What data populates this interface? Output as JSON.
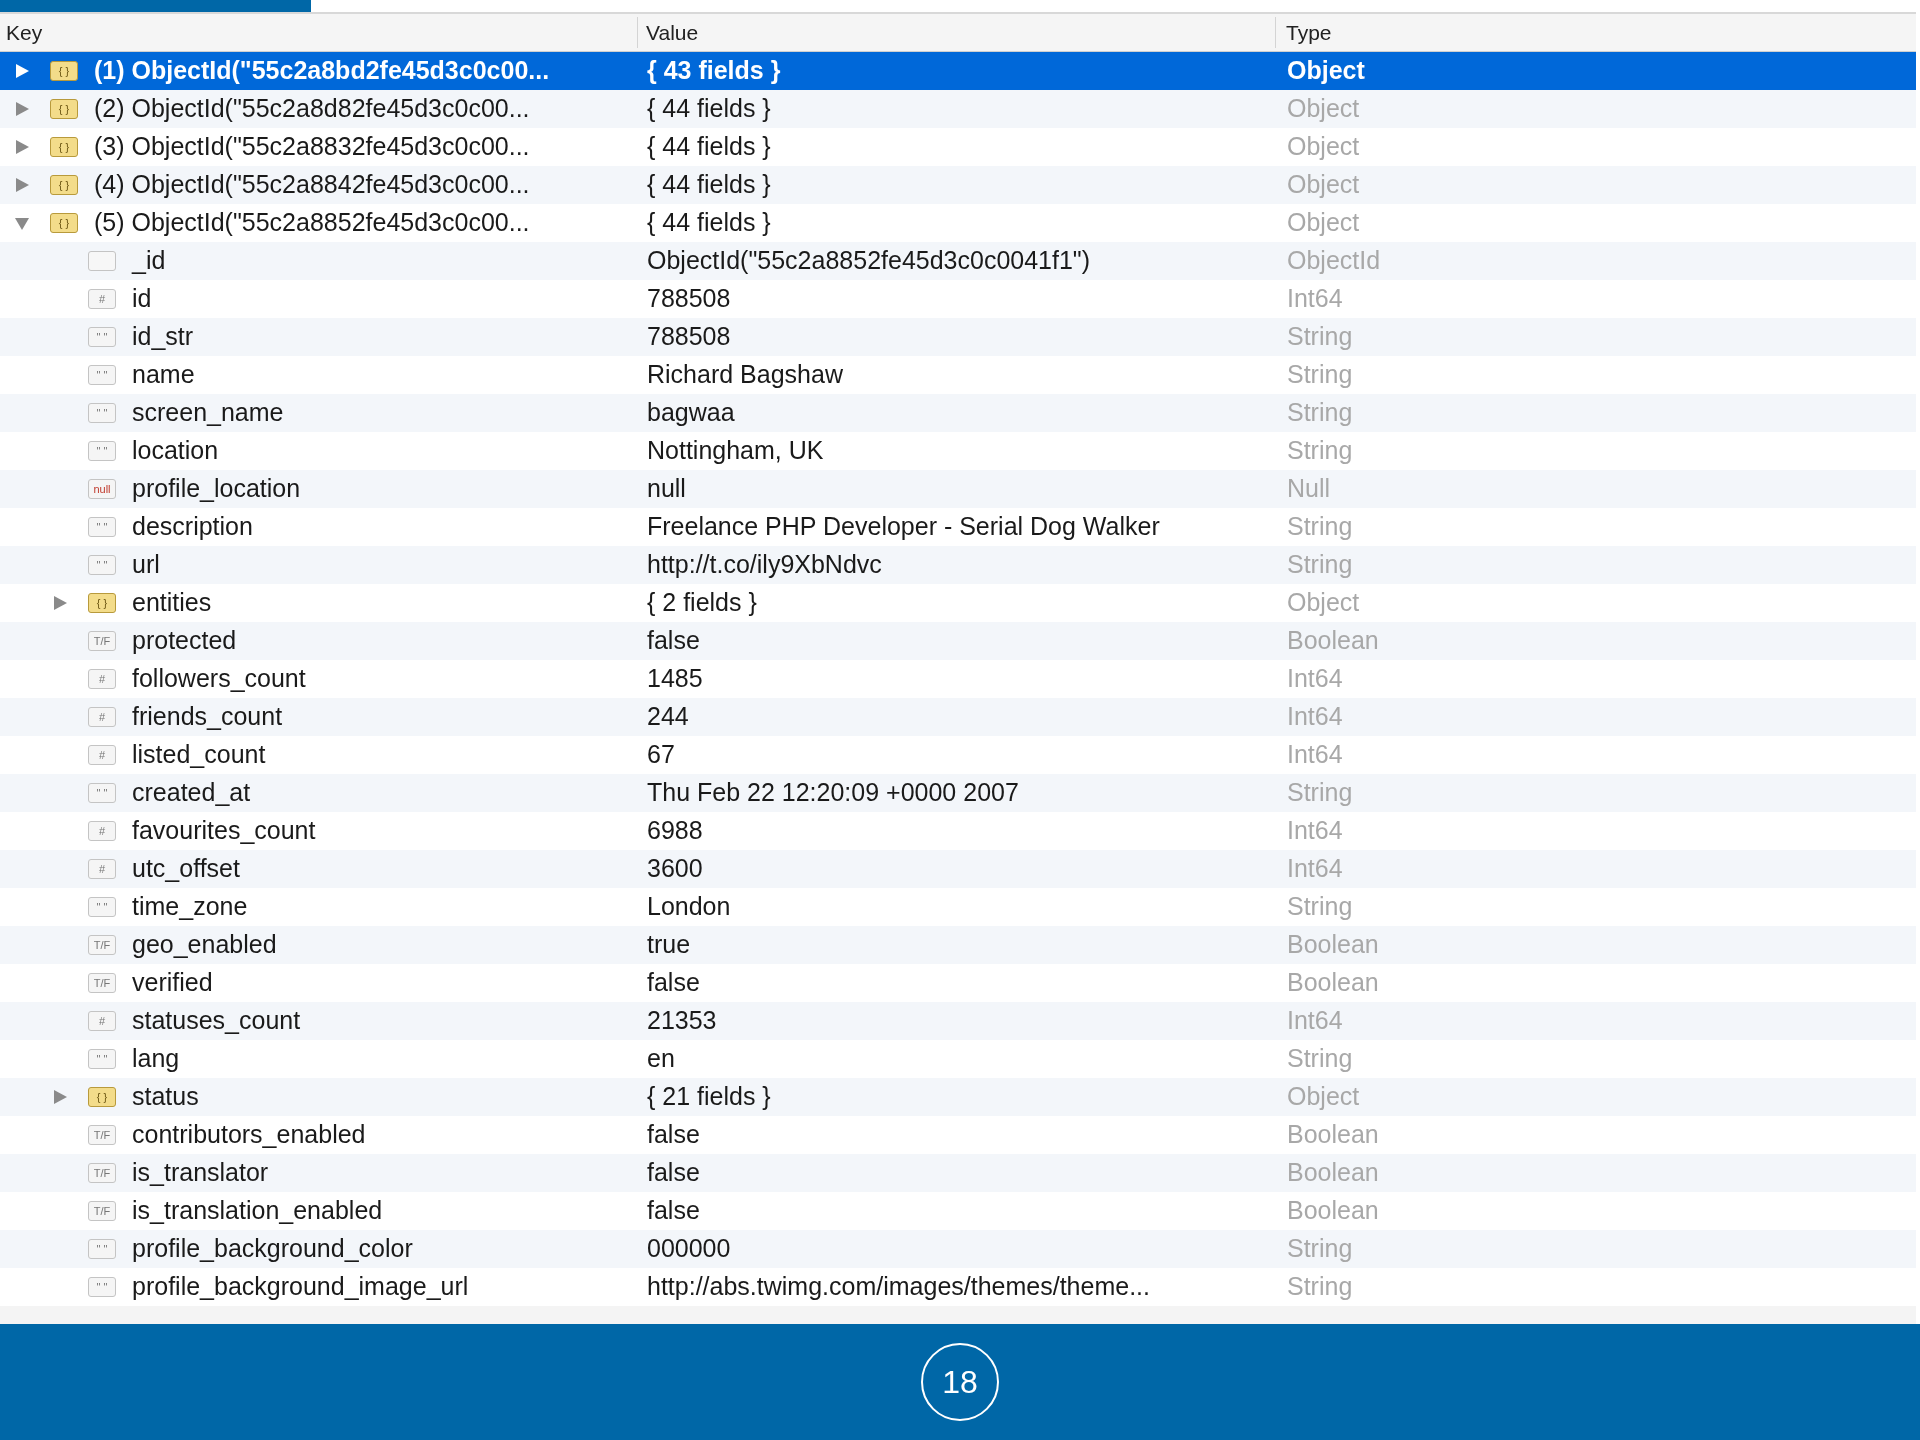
{
  "table": {
    "columns": [
      "Key",
      "Value",
      "Type"
    ],
    "rows": [
      {
        "key": "(1) ObjectId(\"55c2a8bd2fe45d3c0c00...",
        "value": "{ 43 fields }",
        "type": "Object",
        "icon": {
          "kind": "object",
          "label": "{ }"
        },
        "expanded": false,
        "selected": true
      },
      {
        "key": "(2) ObjectId(\"55c2a8d82fe45d3c0c00...",
        "value": "{ 44 fields }",
        "type": "Object",
        "icon": {
          "kind": "object",
          "label": "{ }"
        },
        "expanded": false,
        "selected": false
      },
      {
        "key": "(3) ObjectId(\"55c2a8832fe45d3c0c00...",
        "value": "{ 44 fields }",
        "type": "Object",
        "icon": {
          "kind": "object",
          "label": "{ }"
        },
        "expanded": false,
        "selected": false
      },
      {
        "key": "(4) ObjectId(\"55c2a8842fe45d3c0c00...",
        "value": "{ 44 fields }",
        "type": "Object",
        "icon": {
          "kind": "object",
          "label": "{ }"
        },
        "expanded": false,
        "selected": false
      },
      {
        "key": "(5) ObjectId(\"55c2a8852fe45d3c0c00...",
        "value": "{ 44 fields }",
        "type": "Object",
        "icon": {
          "kind": "object",
          "label": "{ }"
        },
        "expanded": true,
        "selected": false,
        "children": [
          {
            "key": "_id",
            "value": "ObjectId(\"55c2a8852fe45d3c0c0041f1\")",
            "type": "ObjectId",
            "icon": {
              "kind": "objectid"
            },
            "selected": false
          },
          {
            "key": "id",
            "value": "788508",
            "type": "Int64",
            "icon": {
              "kind": "number",
              "label": "#"
            },
            "selected": false
          },
          {
            "key": "id_str",
            "value": "788508",
            "type": "String",
            "icon": {
              "kind": "string",
              "label": "\" \""
            },
            "selected": false
          },
          {
            "key": "name",
            "value": "Richard Bagshaw",
            "type": "String",
            "icon": {
              "kind": "string",
              "label": "\" \""
            },
            "selected": false
          },
          {
            "key": "screen_name",
            "value": "bagwaa",
            "type": "String",
            "icon": {
              "kind": "string",
              "label": "\" \""
            },
            "selected": false
          },
          {
            "key": "location",
            "value": "Nottingham, UK",
            "type": "String",
            "icon": {
              "kind": "string",
              "label": "\" \""
            },
            "selected": false
          },
          {
            "key": "profile_location",
            "value": "null",
            "type": "Null",
            "icon": {
              "kind": "null",
              "label": "null"
            },
            "selected": false
          },
          {
            "key": "description",
            "value": "Freelance PHP Developer - Serial Dog Walker",
            "type": "String",
            "icon": {
              "kind": "string",
              "label": "\" \""
            },
            "selected": false
          },
          {
            "key": "url",
            "value": "http://t.co/ily9XbNdvc",
            "type": "String",
            "icon": {
              "kind": "string",
              "label": "\" \""
            },
            "selected": false
          },
          {
            "key": "entities",
            "value": "{ 2 fields }",
            "type": "Object",
            "icon": {
              "kind": "object",
              "label": "{ }"
            },
            "expanded": false,
            "selected": false
          },
          {
            "key": "protected",
            "value": "false",
            "type": "Boolean",
            "icon": {
              "kind": "boolean",
              "label": "T/F"
            },
            "selected": false
          },
          {
            "key": "followers_count",
            "value": "1485",
            "type": "Int64",
            "icon": {
              "kind": "number",
              "label": "#"
            },
            "selected": false
          },
          {
            "key": "friends_count",
            "value": "244",
            "type": "Int64",
            "icon": {
              "kind": "number",
              "label": "#"
            },
            "selected": false
          },
          {
            "key": "listed_count",
            "value": "67",
            "type": "Int64",
            "icon": {
              "kind": "number",
              "label": "#"
            },
            "selected": false
          },
          {
            "key": "created_at",
            "value": "Thu Feb 22 12:20:09 +0000 2007",
            "type": "String",
            "icon": {
              "kind": "string",
              "label": "\" \""
            },
            "selected": false
          },
          {
            "key": "favourites_count",
            "value": "6988",
            "type": "Int64",
            "icon": {
              "kind": "number",
              "label": "#"
            },
            "selected": false
          },
          {
            "key": "utc_offset",
            "value": "3600",
            "type": "Int64",
            "icon": {
              "kind": "number",
              "label": "#"
            },
            "selected": false
          },
          {
            "key": "time_zone",
            "value": "London",
            "type": "String",
            "icon": {
              "kind": "string",
              "label": "\" \""
            },
            "selected": false
          },
          {
            "key": "geo_enabled",
            "value": "true",
            "type": "Boolean",
            "icon": {
              "kind": "boolean",
              "label": "T/F"
            },
            "selected": false
          },
          {
            "key": "verified",
            "value": "false",
            "type": "Boolean",
            "icon": {
              "kind": "boolean",
              "label": "T/F"
            },
            "selected": false
          },
          {
            "key": "statuses_count",
            "value": "21353",
            "type": "Int64",
            "icon": {
              "kind": "number",
              "label": "#"
            },
            "selected": false
          },
          {
            "key": "lang",
            "value": "en",
            "type": "String",
            "icon": {
              "kind": "string",
              "label": "\" \""
            },
            "selected": false
          },
          {
            "key": "status",
            "value": "{ 21 fields }",
            "type": "Object",
            "icon": {
              "kind": "object",
              "label": "{ }"
            },
            "expanded": false,
            "selected": false
          },
          {
            "key": "contributors_enabled",
            "value": "false",
            "type": "Boolean",
            "icon": {
              "kind": "boolean",
              "label": "T/F"
            },
            "selected": false
          },
          {
            "key": "is_translator",
            "value": "false",
            "type": "Boolean",
            "icon": {
              "kind": "boolean",
              "label": "T/F"
            },
            "selected": false
          },
          {
            "key": "is_translation_enabled",
            "value": "false",
            "type": "Boolean",
            "icon": {
              "kind": "boolean",
              "label": "T/F"
            },
            "selected": false
          },
          {
            "key": "profile_background_color",
            "value": "000000",
            "type": "String",
            "icon": {
              "kind": "string",
              "label": "\" \""
            },
            "selected": false
          },
          {
            "key": "profile_background_image_url",
            "value": "http://abs.twimg.com/images/themes/theme...",
            "type": "String",
            "icon": {
              "kind": "string",
              "label": "\" \""
            },
            "selected": false
          }
        ]
      }
    ]
  },
  "footer": {
    "slide_number": "18"
  }
}
